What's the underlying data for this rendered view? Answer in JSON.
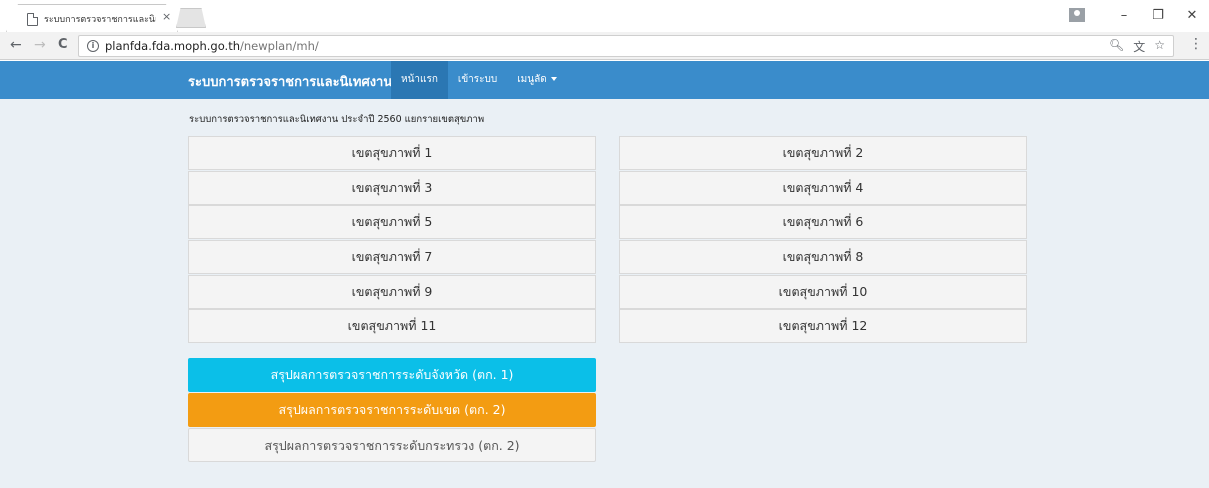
{
  "browser": {
    "tab_title": "ระบบการตรวจราชการและนิเ",
    "tab_close": "×",
    "window_controls": {
      "minimize": "–",
      "restore": "❐",
      "close": "✕"
    },
    "nav": {
      "back": "←",
      "forward": "→",
      "reload": "C"
    },
    "url_host": "planfda.fda.moph.go.th",
    "url_path": "/newplan/mh/",
    "menu": "⋮"
  },
  "navbar": {
    "brand": "ระบบการตรวจราชการและนิเทศงาน",
    "items": [
      {
        "label": "หน้าแรก",
        "active": true
      },
      {
        "label": "เข้าระบบ",
        "active": false
      },
      {
        "label": "เมนูลัด",
        "active": false,
        "dropdown": true
      }
    ]
  },
  "main": {
    "heading": "ระบบการตรวจราชการและนิเทศงาน ประจำปี 2560 แยกรายเขตสุขภาพ",
    "regions": [
      "เขตสุขภาพที่ 1",
      "เขตสุขภาพที่ 2",
      "เขตสุขภาพที่ 3",
      "เขตสุขภาพที่ 4",
      "เขตสุขภาพที่ 5",
      "เขตสุขภาพที่ 6",
      "เขตสุขภาพที่ 7",
      "เขตสุขภาพที่ 8",
      "เขตสุขภาพที่ 9",
      "เขตสุขภาพที่ 10",
      "เขตสุขภาพที่ 11",
      "เขตสุขภาพที่ 12"
    ],
    "summary_buttons": [
      {
        "label": "สรุปผลการตรวจราชการระดับจังหวัด (ตก. 1)",
        "color": "#0bbfe8"
      },
      {
        "label": "สรุปผลการตรวจราชการระดับเขต (ตก. 2)",
        "color": "#f39c12"
      },
      {
        "label": "สรุปผลการตรวจราชการระดับกระทรวง (ตก. 2)",
        "color": "#f4f4f4"
      }
    ]
  },
  "colors": {
    "navbar": "#3a8ccb",
    "navbar_active": "#2b77b3",
    "background": "#eaf0f5"
  }
}
